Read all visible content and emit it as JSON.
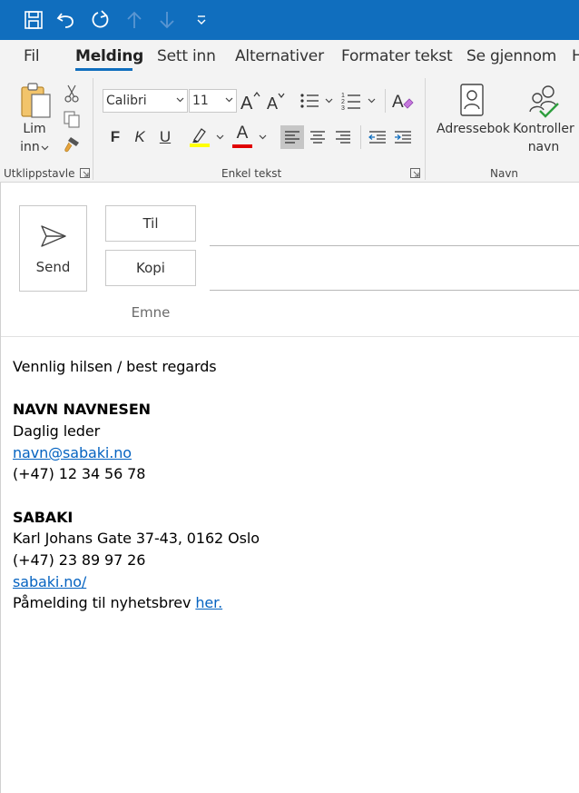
{
  "quick_access": [
    {
      "name": "save-icon"
    },
    {
      "name": "undo-icon"
    },
    {
      "name": "redo-icon"
    },
    {
      "name": "previous-item-icon"
    },
    {
      "name": "next-item-icon"
    },
    {
      "name": "customize-toolbar-icon"
    }
  ],
  "tabs": {
    "fil": "Fil",
    "melding": "Melding",
    "sett_inn": "Sett inn",
    "alternativer": "Alternativer",
    "formater_tekst": "Formater tekst",
    "se_gjennom": "Se gjennom",
    "hjelp": "H"
  },
  "ribbon": {
    "clipboard": {
      "paste_line1": "Lim",
      "paste_line2": "inn",
      "group_label": "Utklippstavle"
    },
    "basic_text": {
      "font_name": "Calibri",
      "font_size": "11",
      "bold": "F",
      "italic": "K",
      "underline": "U",
      "font_color_letter": "A",
      "group_label": "Enkel tekst"
    },
    "names": {
      "address_book": "Adressebok",
      "check_names_line1": "Kontroller",
      "check_names_line2": "navn",
      "group_label": "Navn"
    }
  },
  "compose": {
    "send": "Send",
    "to": "Til",
    "cc": "Kopi",
    "subject": "Emne"
  },
  "signature": {
    "greeting": "Vennlig hilsen / best regards",
    "name": "NAVN NAVNESEN",
    "title": "Daglig leder",
    "email": "navn@sabaki.no",
    "phone": "(+47) 12 34 56 78",
    "company": "SABAKI",
    "address": "Karl Johans Gate 37-43, 0162 Oslo",
    "company_phone": "(+47) 23 89 97 26",
    "website": "sabaki.no/",
    "newsletter_prefix": "Påmelding til nyhetsbrev ",
    "newsletter_link": "her."
  },
  "colors": {
    "titlebar": "#106ebe",
    "highlight": "#ffff00",
    "font_color": "#e00000",
    "link": "#0563c1"
  }
}
